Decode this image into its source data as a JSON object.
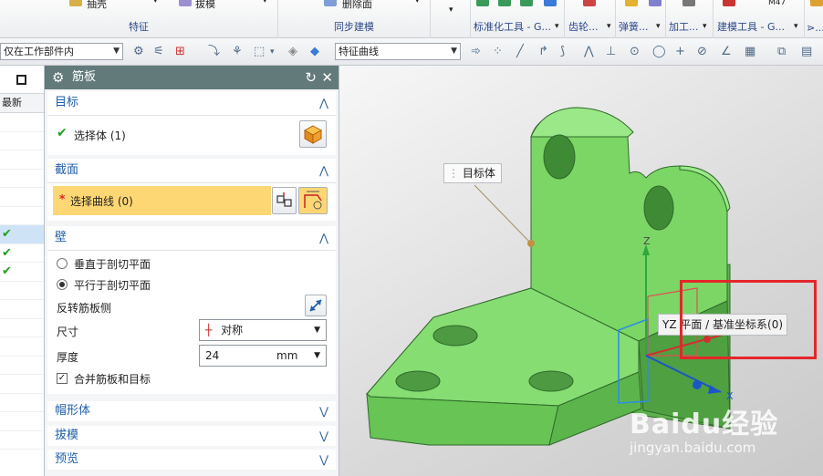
{
  "ribbon": {
    "groups": [
      {
        "caption": "特征",
        "buttons": [
          "抽壳",
          "拔模"
        ]
      },
      {
        "caption": "同步建模",
        "buttons": [
          "删除面"
        ]
      },
      {
        "caption": "标准化工具 - G...",
        "buttons": []
      },
      {
        "caption": "齿轮...",
        "buttons": []
      },
      {
        "caption": "弹簧...",
        "buttons": []
      },
      {
        "caption": "加工...",
        "buttons": []
      },
      {
        "caption": "建模工具 - G...",
        "buttons": []
      },
      {
        "caption": "⋗...",
        "buttons": []
      }
    ]
  },
  "toolbar": {
    "scope_filter": "仅在工作部件内",
    "curve_rule": "特征曲线"
  },
  "navigator": {
    "column_header": "最新",
    "checked_rows": [
      6,
      7,
      8
    ],
    "selected_row": 6,
    "row_count": 18
  },
  "dialog": {
    "title": "筋板",
    "target": {
      "header": "目标",
      "select_body": "选择体 (1)"
    },
    "section": {
      "header": "截面",
      "select_curve": "选择曲线 (0)",
      "required_mark": "*"
    },
    "wall": {
      "header": "壁",
      "option_perpendicular": "垂直于剖切平面",
      "option_parallel": "平行于剖切平面",
      "selected_option": "平行于剖切平面",
      "flip_label": "反转筋板侧",
      "dimension_label": "尺寸",
      "dimension_value": "对称",
      "thickness_label": "厚度",
      "thickness_value": "24",
      "thickness_unit": "mm",
      "combine_label": "合并筋板和目标",
      "combine_checked": true
    },
    "collapsed_groups": [
      "帽形体",
      "拔模",
      "预览"
    ]
  },
  "viewport": {
    "target_tag": "目标体",
    "plane_tooltip": "YZ 平面 / 基准坐标系(0)",
    "axis_z": "Z",
    "axis_x": "X",
    "watermark": "Baidu经验",
    "watermark_url": "jingyan.baidu.com",
    "model_color": "#7cd46a",
    "highlight_color": "#e4262a"
  }
}
